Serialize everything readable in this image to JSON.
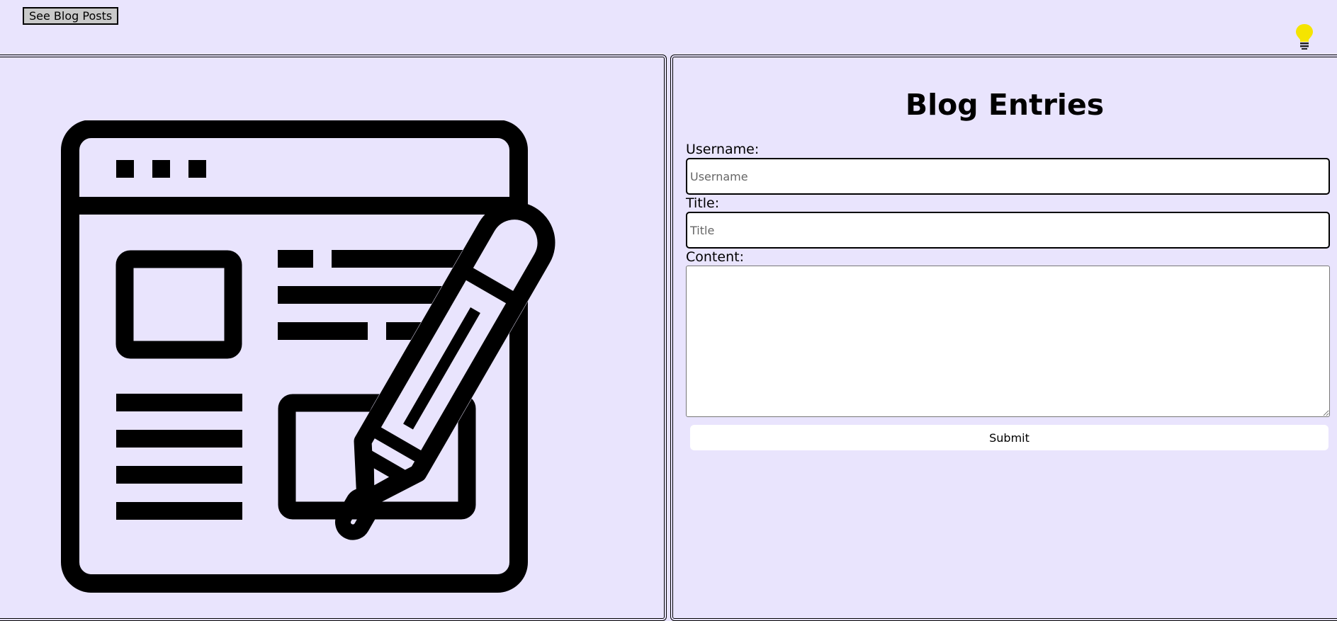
{
  "header": {
    "see_posts_label": "See Blog Posts",
    "theme_icon": "lightbulb-icon",
    "theme_icon_color": "#f5e400"
  },
  "illustration": {
    "icon": "blog-writing-icon"
  },
  "form": {
    "title": "Blog Entries",
    "username_label": "Username:",
    "username_placeholder": "Username",
    "title_label": "Title:",
    "title_placeholder": "Title",
    "content_label": "Content:",
    "submit_label": "Submit"
  },
  "colors": {
    "background": "#e9e4fd",
    "border": "#000000",
    "field_background": "#ffffff"
  }
}
